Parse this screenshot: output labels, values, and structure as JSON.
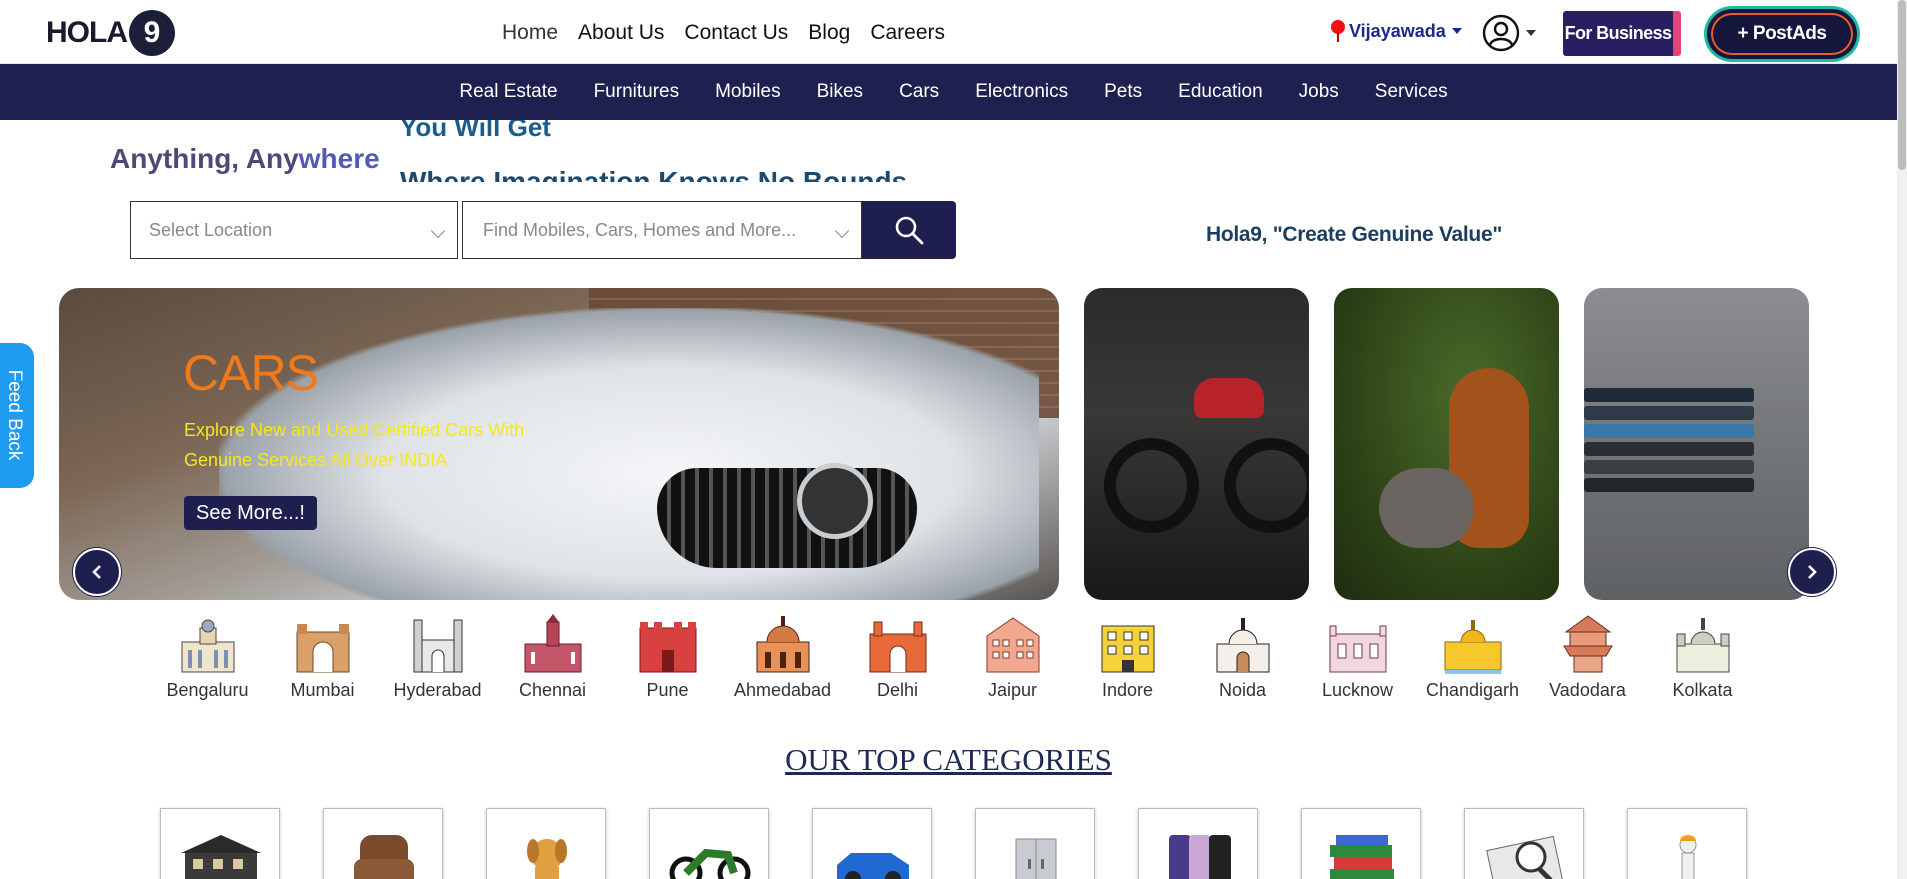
{
  "header": {
    "logo_text": "HOLA",
    "logo_badge": "9",
    "nav": [
      "Home",
      "About Us",
      "Contact Us",
      "Blog",
      "Careers"
    ],
    "location": "Vijayawada",
    "for_business": "For Business",
    "post_ads": "+ PostAds"
  },
  "categories_nav": [
    "Real Estate",
    "Furnitures",
    "Mobiles",
    "Bikes",
    "Cars",
    "Electronics",
    "Pets",
    "Education",
    "Jobs",
    "Services"
  ],
  "hero_text": {
    "anything_part1": "Anything, Any",
    "anything_part2": "where",
    "rotating_1": "You Will Get",
    "rotating_2": "Where Imagination Knows No Bounds"
  },
  "search": {
    "location_placeholder": "Select Location",
    "query_placeholder": "Find Mobiles, Cars, Homes and More...",
    "tagline": "Hola9, \"Create Genuine Value\""
  },
  "carousel": {
    "title": "CARS",
    "description_line1": "Explore New and Used Certified Cars With",
    "description_line2": "Genuine Services All Over INDIA",
    "cta": "See More...!"
  },
  "feedback_label": "Feed Back",
  "cities": [
    "Bengaluru",
    "Mumbai",
    "Hyderabad",
    "Chennai",
    "Pune",
    "Ahmedabad",
    "Delhi",
    "Jaipur",
    "Indore",
    "Noida",
    "Lucknow",
    "Chandigarh",
    "Vadodara",
    "Kolkata"
  ],
  "top_categories_heading": "OUR TOP CATEGORIES",
  "colors": {
    "navy": "#1e1f4f",
    "orange": "#f07a1a",
    "yellow": "#f5e818",
    "feedback_blue": "#1e9cf0"
  }
}
